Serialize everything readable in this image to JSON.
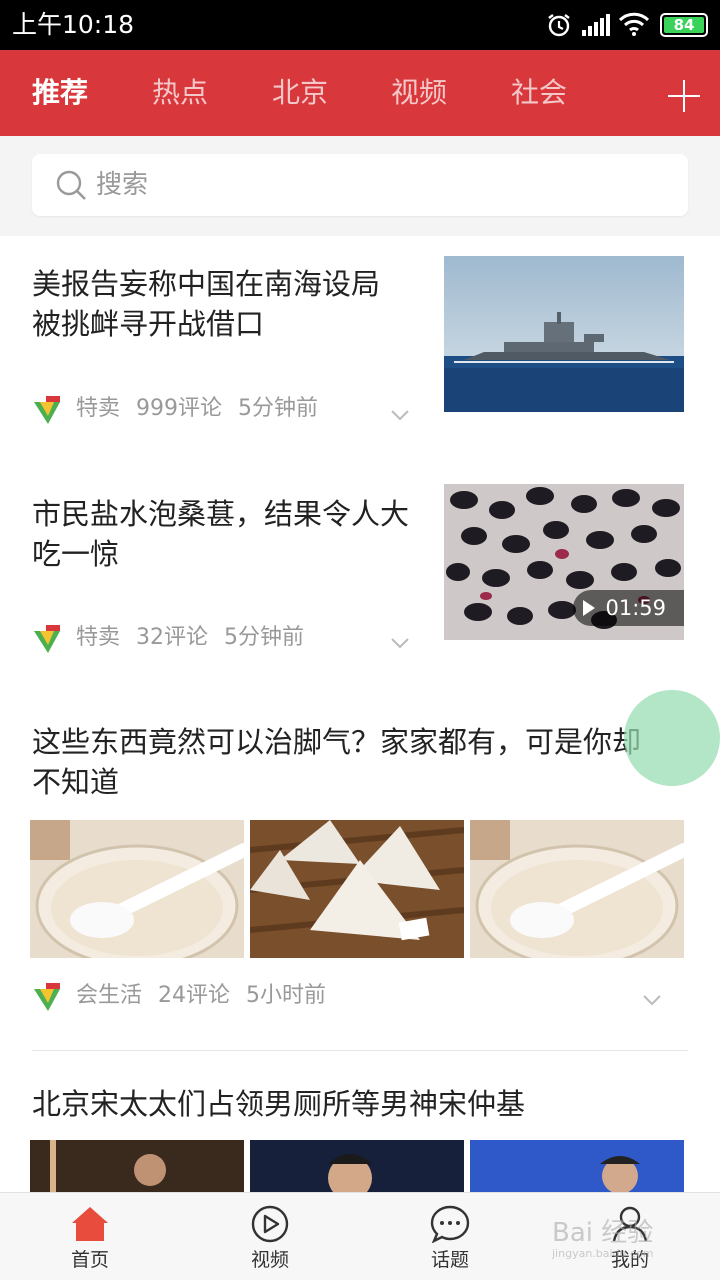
{
  "status_bar": {
    "time": "上午10:18",
    "battery": "84"
  },
  "channels": [
    {
      "label": "推荐",
      "active": true
    },
    {
      "label": "热点"
    },
    {
      "label": "北京"
    },
    {
      "label": "视频"
    },
    {
      "label": "社会"
    }
  ],
  "search": {
    "placeholder": "搜索"
  },
  "articles": [
    {
      "title_line1": "美报告妄称中国在南海设局",
      "title_line2": "被挑衅寻开战借口",
      "source": "特卖",
      "comments": "999评论",
      "time": "5分钟前"
    },
    {
      "title_line1": "市民盐水泡桑葚，结果令人大",
      "title_line2": "吃一惊",
      "source": "特卖",
      "comments": "32评论",
      "time": "5分钟前",
      "duration": "01:59"
    },
    {
      "title_line1": "这些东西竟然可以治脚气？家家都有，可是你却",
      "title_line2": "不知道",
      "source": "会生活",
      "comments": "24评论",
      "time": "5小时前"
    },
    {
      "title_line1": "北京宋太太们占领男厕所等男神宋仲基"
    }
  ],
  "tabbar": [
    {
      "label": "首页",
      "icon": "home-icon",
      "active": true
    },
    {
      "label": "视频",
      "icon": "video-play-icon"
    },
    {
      "label": "话题",
      "icon": "topic-bubble-icon"
    },
    {
      "label": "我的",
      "icon": "profile-icon"
    }
  ],
  "watermark": {
    "text": "Bai 经验",
    "sub": "jingyan.baidu.com"
  },
  "colors": {
    "brand_red": "#d8383c",
    "tab_active": "#e74c3c",
    "battery": "#39d35a"
  }
}
